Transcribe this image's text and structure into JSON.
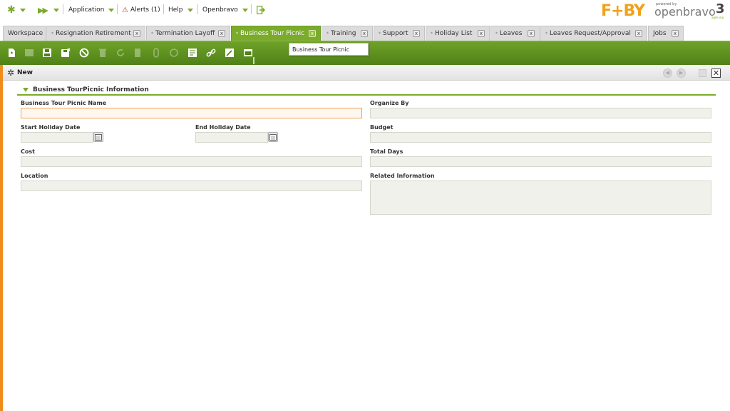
{
  "topnav": {
    "application": "Application",
    "alerts": "Alerts (1)",
    "help": "Help",
    "user": "Openbravo"
  },
  "branding": {
    "company_logo": "F+BY",
    "powered_by": "powered by",
    "product": "openbravo",
    "version": "3",
    "tagline": "agile erp"
  },
  "tabs": [
    {
      "label": "Workspace"
    },
    {
      "label": "Resignation Retirement"
    },
    {
      "label": "Termination Layoff"
    },
    {
      "label": "Business Tour Picnic"
    },
    {
      "label": "Training"
    },
    {
      "label": "Support"
    },
    {
      "label": "Holiday List"
    },
    {
      "label": "Leaves"
    },
    {
      "label": "Leaves Request/Approval"
    },
    {
      "label": "Jobs"
    }
  ],
  "tab_close_glyph": "x",
  "tab_modified_glyph": "*",
  "tooltip": "Business Tour Picnic",
  "status": {
    "mode": "New"
  },
  "section": {
    "title": "Business TourPicnic Information"
  },
  "form": {
    "name_label": "Business Tour Picnic Name",
    "organize_by_label": "Organize By",
    "start_date_label": "Start Holiday Date",
    "end_date_label": "End Holiday Date",
    "budget_label": "Budget",
    "cost_label": "Cost",
    "total_days_label": "Total Days",
    "location_label": "Location",
    "related_info_label": "Related Information",
    "name_value": "",
    "organize_by_value": "",
    "start_date_value": "",
    "end_date_value": "",
    "budget_value": "",
    "cost_value": "",
    "total_days_value": "",
    "location_value": "",
    "related_info_value": ""
  },
  "colors": {
    "accent_green": "#7bab2b",
    "accent_orange": "#f08c1b",
    "field_bg": "#f0f1ea"
  }
}
